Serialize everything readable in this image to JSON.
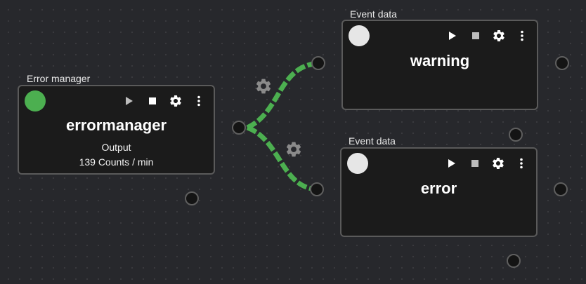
{
  "colors": {
    "canvas_background": "#27282c",
    "node_background": "#1b1b1b",
    "node_border": "#5a5a5a",
    "status_active": "#4caf50",
    "status_idle": "#e6e6e6",
    "edge": "#4caf50",
    "port_fill": "#141414",
    "port_border": "#5f5f5f",
    "edge_gear": "#8a8a8a"
  },
  "icons": {
    "play": "play-icon",
    "stop": "stop-icon",
    "settings": "gear-icon",
    "menu": "kebab-menu-icon"
  },
  "nodes": {
    "error_manager": {
      "title": "Error manager",
      "name": "errormanager",
      "status": "active",
      "output_label": "Output",
      "output_rate": "139 Counts / min"
    },
    "warning": {
      "title": "Event data",
      "name": "warning",
      "status": "idle"
    },
    "error": {
      "title": "Event data",
      "name": "error",
      "status": "idle"
    }
  }
}
